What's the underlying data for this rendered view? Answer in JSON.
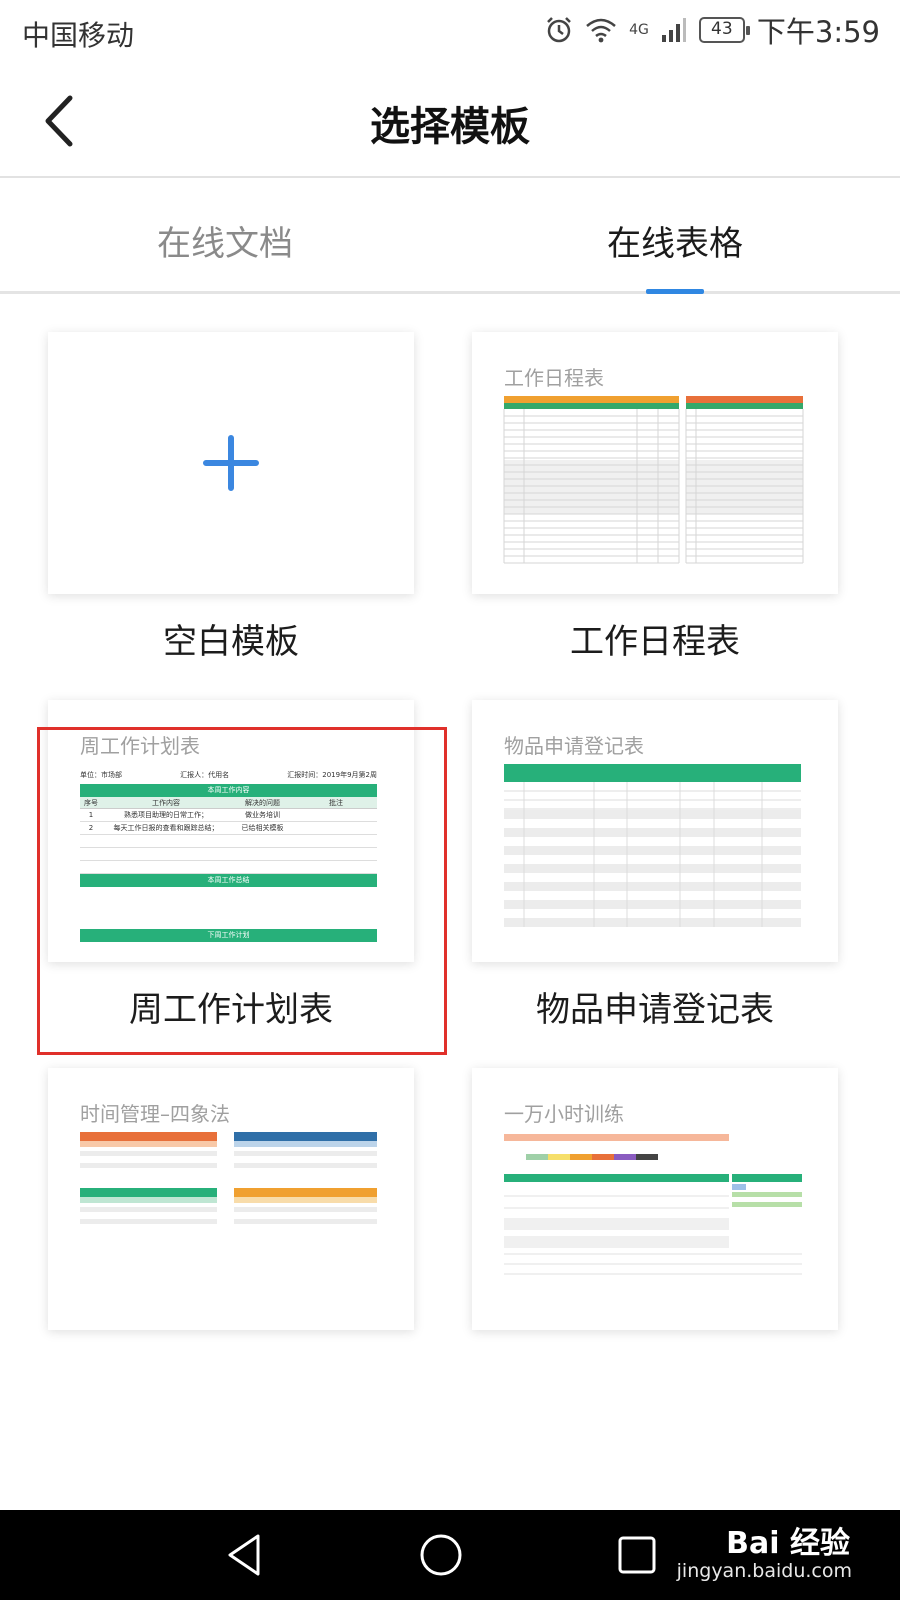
{
  "status_bar": {
    "carrier": "中国移动",
    "battery": "43",
    "network": "4G",
    "time": "下午3:59",
    "icons": [
      "alarm-icon",
      "wifi-icon",
      "signal-icon",
      "battery-icon"
    ]
  },
  "header": {
    "title": "选择模板",
    "back_icon": "chevron-left-icon"
  },
  "tabs": [
    {
      "label": "在线文档",
      "active": false
    },
    {
      "label": "在线表格",
      "active": true
    }
  ],
  "accent_color": "#2f87e2",
  "highlight_color": "#e0302a",
  "templates": [
    {
      "caption": "空白模板",
      "thumb_title": "",
      "icon": "plus-icon"
    },
    {
      "caption": "工作日程表",
      "thumb_title": "工作日程表"
    },
    {
      "caption": "周工作计划表",
      "thumb_title": "周工作计划表",
      "highlighted": true,
      "thumb": {
        "unit": "单位：市场部",
        "reporter": "汇报人：代用名",
        "report_time": "汇报时间：2019年9月第2周",
        "section1": "本周工作内容",
        "columns": [
          "序号",
          "工作内容",
          "解决的问题",
          "批注"
        ],
        "rows": [
          [
            "1",
            "熟悉项目助理的日常工作；",
            "做业务培训",
            ""
          ],
          [
            "2",
            "每天工作日报的查看和跟踪总结；",
            "已给相关模板",
            ""
          ]
        ],
        "section2": "本周工作总结",
        "section3": "下周工作计划"
      }
    },
    {
      "caption": "物品申请登记表",
      "thumb_title": "物品申请登记表"
    },
    {
      "caption": "",
      "thumb_title": "时间管理–四象法"
    },
    {
      "caption": "",
      "thumb_title": "一万小时训练"
    }
  ],
  "nav": {
    "icons": [
      "back-triangle-icon",
      "home-circle-icon",
      "recents-square-icon"
    ]
  },
  "watermark": {
    "brand": "Bai 经验",
    "site": "jingyan.baidu.com"
  }
}
